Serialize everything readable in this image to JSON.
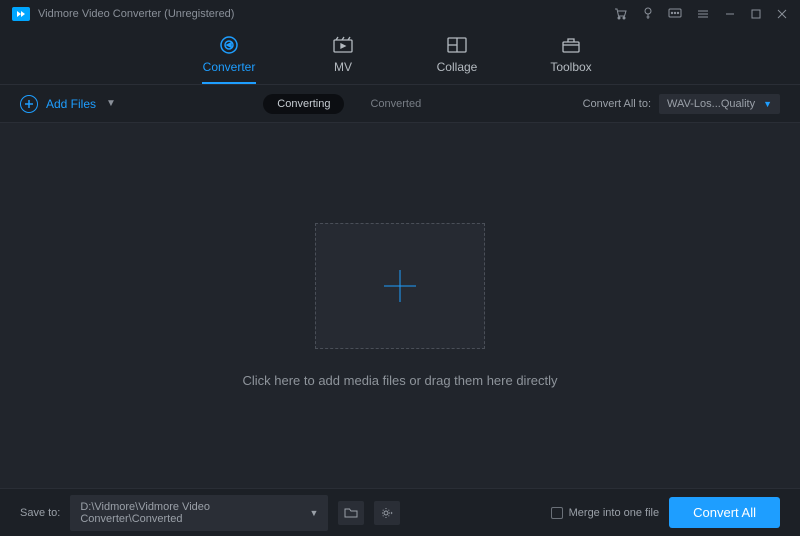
{
  "titlebar": {
    "title": "Vidmore Video Converter (Unregistered)"
  },
  "nav": {
    "tabs": [
      {
        "label": "Converter"
      },
      {
        "label": "MV"
      },
      {
        "label": "Collage"
      },
      {
        "label": "Toolbox"
      }
    ]
  },
  "toolbar": {
    "add_files_label": "Add Files",
    "converting_label": "Converting",
    "converted_label": "Converted",
    "convert_all_to_label": "Convert All to:",
    "format_value": "WAV-Los...Quality"
  },
  "dropzone": {
    "hint": "Click here to add media files or drag them here directly"
  },
  "footer": {
    "save_to_label": "Save to:",
    "path": "D:\\Vidmore\\Vidmore Video Converter\\Converted",
    "merge_label": "Merge into one file",
    "convert_button": "Convert All"
  }
}
